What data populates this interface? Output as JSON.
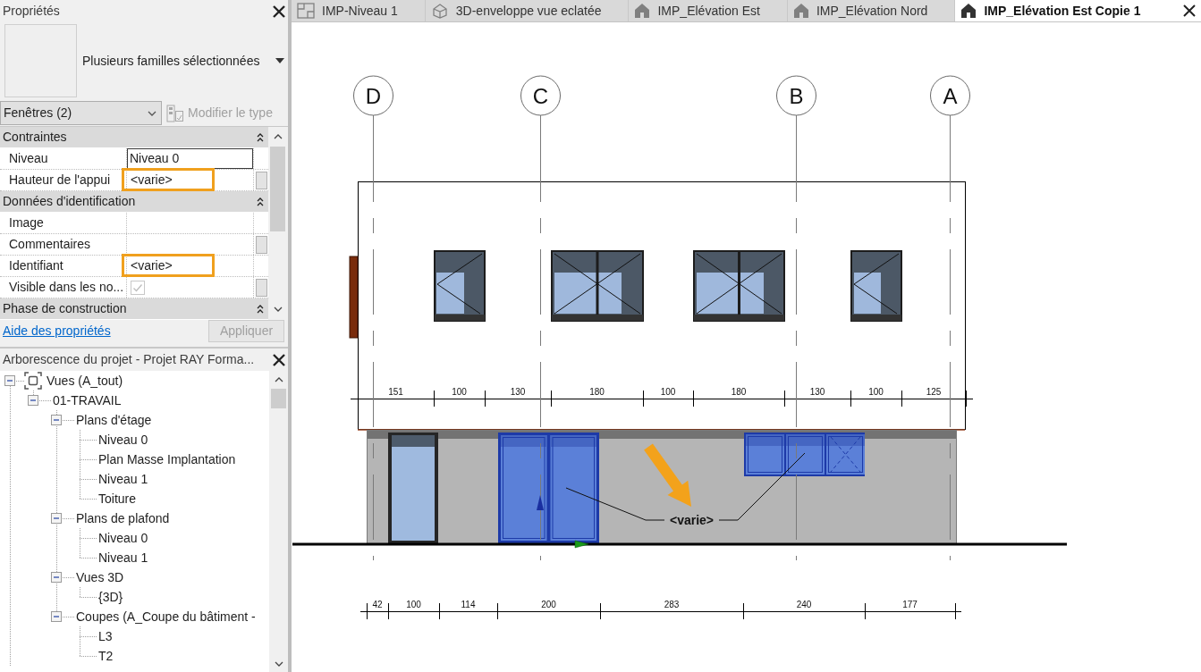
{
  "properties_panel": {
    "title": "Propriétés",
    "type_selector": "Plusieurs familles sélectionnées",
    "filter": "Fenêtres (2)",
    "edit_type_button": {
      "label": "Modifier le type",
      "disabled": true
    },
    "groups": [
      {
        "label": "Contraintes",
        "rows": [
          {
            "label": "Niveau",
            "value": "Niveau 0",
            "kind": "input",
            "highlighted": false,
            "side_button": false
          },
          {
            "label": "Hauteur de l'appui",
            "value": "<varie>",
            "kind": "text",
            "highlighted": true,
            "side_button": true
          }
        ]
      },
      {
        "label": "Données d'identification",
        "rows": [
          {
            "label": "Image",
            "kind": "text",
            "highlighted": false,
            "side_button": false
          },
          {
            "label": "Commentaires",
            "kind": "text",
            "highlighted": false,
            "side_button": true
          },
          {
            "label": "Identifiant",
            "value": "<varie>",
            "kind": "text",
            "highlighted": true,
            "side_button": false
          },
          {
            "label": "Visible dans les no...",
            "kind": "checkbox",
            "checked": true,
            "disabled": true,
            "highlighted": false,
            "side_button": true
          }
        ]
      },
      {
        "label": "Phase de construction"
      }
    ],
    "help_link": "Aide des propriétés",
    "apply_button": {
      "label": "Appliquer",
      "disabled": true
    }
  },
  "project_browser": {
    "title": "Arborescence du projet - Projet RAY Forma...",
    "tree": [
      {
        "label": "Vues (A_tout)",
        "expanded": true,
        "children": [
          {
            "label": "01-TRAVAIL",
            "expanded": true,
            "children": [
              {
                "label": "Plans d'étage",
                "expanded": true,
                "children": [
                  {
                    "label": "Niveau 0"
                  },
                  {
                    "label": "Plan Masse Implantation"
                  },
                  {
                    "label": "Niveau 1"
                  },
                  {
                    "label": "Toiture"
                  }
                ]
              },
              {
                "label": "Plans de plafond",
                "expanded": true,
                "children": [
                  {
                    "label": "Niveau 0"
                  },
                  {
                    "label": "Niveau 1"
                  }
                ]
              },
              {
                "label": "Vues 3D",
                "expanded": true,
                "children": [
                  {
                    "label": "{3D}"
                  }
                ]
              },
              {
                "label": "Coupes (A_Coupe du bâtiment -",
                "expanded": true,
                "children": [
                  {
                    "label": "L3"
                  },
                  {
                    "label": "T2"
                  }
                ]
              }
            ]
          }
        ]
      }
    ]
  },
  "tabs": [
    {
      "label": "IMP-Niveau 1",
      "kind": "plan",
      "selected": false
    },
    {
      "label": "3D-enveloppe vue eclatée",
      "kind": "perspective",
      "selected": false
    },
    {
      "label": "IMP_Elévation Est",
      "kind": "elevation",
      "selected": false
    },
    {
      "label": "IMP_Elévation Nord",
      "kind": "elevation",
      "selected": false
    },
    {
      "label": "IMP_Elévation Est Copie 1",
      "kind": "elevation",
      "selected": true
    }
  ],
  "elevation": {
    "grid_labels": [
      "D",
      "C",
      "B",
      "A"
    ],
    "upper_dimensions": [
      "151",
      "100",
      "130",
      "180",
      "100",
      "180",
      "130",
      "100",
      "125"
    ],
    "openings": [
      {
        "kind": "glazed_door",
        "selected": false
      },
      {
        "kind": "double_door",
        "selected": true
      },
      {
        "kind": "window_strip",
        "selected": true
      }
    ],
    "tag": "<varie>",
    "lower_dimensions": [
      "42",
      "100",
      "114",
      "200",
      "283",
      "240",
      "177"
    ]
  }
}
